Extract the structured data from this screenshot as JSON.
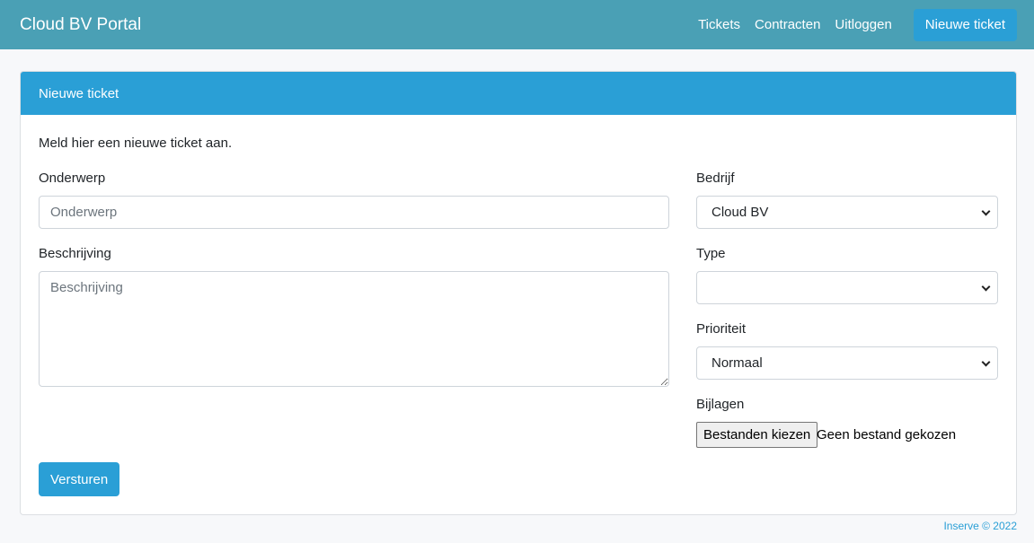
{
  "app": {
    "brand": "Cloud BV Portal",
    "nav": [
      {
        "label": "Tickets"
      },
      {
        "label": "Contracten"
      },
      {
        "label": "Uitloggen"
      }
    ],
    "cta_label": "Nieuwe ticket"
  },
  "card": {
    "title": "Nieuwe ticket",
    "intro": "Meld hier een nieuwe ticket aan."
  },
  "form": {
    "subject": {
      "label": "Onderwerp",
      "placeholder": "Onderwerp",
      "value": ""
    },
    "description": {
      "label": "Beschrijving",
      "placeholder": "Beschrijving",
      "value": ""
    },
    "company": {
      "label": "Bedrijf",
      "selected": "Cloud BV"
    },
    "type": {
      "label": "Type",
      "selected": ""
    },
    "priority": {
      "label": "Prioriteit",
      "selected": "Normaal"
    },
    "attachments": {
      "label": "Bijlagen",
      "button_label": "Bestanden kiezen",
      "status": "Geen bestand gekozen"
    },
    "submit_label": "Versturen"
  },
  "footer": {
    "text": "Inserve © 2022"
  },
  "colors": {
    "navbar": "#4aa0b5",
    "primary": "#2a9fd6"
  }
}
